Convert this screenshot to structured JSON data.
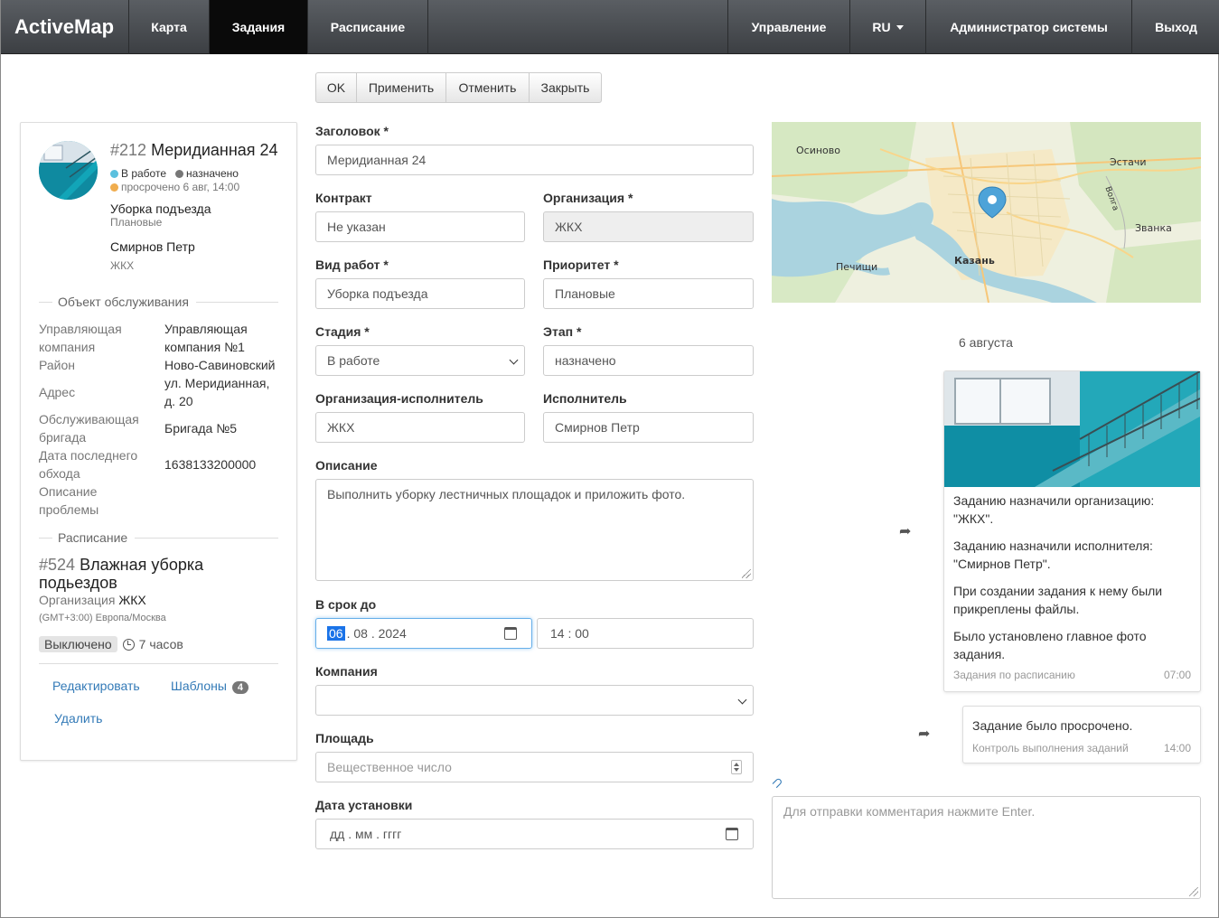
{
  "navbar": {
    "brand": "ActiveMap",
    "items": [
      {
        "label": "Карта"
      },
      {
        "label": "Задания"
      },
      {
        "label": "Расписание"
      }
    ],
    "right_items": [
      {
        "label": "Управление"
      },
      {
        "label": "RU"
      },
      {
        "label": "Администратор системы"
      },
      {
        "label": "Выход"
      }
    ]
  },
  "toolbar": {
    "ok": "OK",
    "apply": "Применить",
    "cancel": "Отменить",
    "close": "Закрыть"
  },
  "card": {
    "task_number": "#212",
    "task_title": "Меридианная 24",
    "stage": "В работе",
    "stage_color": "#5bc0de",
    "step": "назначено",
    "step_color": "#777777",
    "overdue": "просрочено 6 авг, 14:00",
    "overdue_color": "#f0ad4e",
    "work_type": "Уборка подъезда",
    "priority": "Плановые",
    "executor": "Смирнов Петр",
    "executor_org": "ЖКХ",
    "object_section": "Объект обслуживания",
    "fields": {
      "mgmt_label": "Управляющая компания",
      "mgmt_value": "Управляющая компания №1",
      "district_label": "Район",
      "district_value": "Ново-Савиновский",
      "address_label": "Адрес",
      "address_value": "ул. Меридианная, д. 20",
      "brigade_label": "Обслуживающая бригада",
      "brigade_value": "Бригада №5",
      "last_visit_label": "Дата последнего обхода",
      "last_visit_value": "1638133200000",
      "problem_label": "Описание проблемы",
      "problem_value": ""
    },
    "schedule_section": "Расписание",
    "schedule_number": "#524",
    "schedule_title": "Влажная уборка подьездов",
    "schedule_org_label": "Организация",
    "schedule_org_value": "ЖКХ",
    "timezone": "(GMT+3:00) Европа/Москва",
    "schedule_state": "Выключено",
    "schedule_period": "7 часов",
    "edit_link": "Редактировать",
    "templates_link": "Шаблоны",
    "templates_count": "4",
    "delete_link": "Удалить"
  },
  "form": {
    "title_label": "Заголовок *",
    "title_value": "Меридианная 24",
    "contract_label": "Контракт",
    "contract_value": "Не указан",
    "org_label": "Организация *",
    "org_value": "ЖКХ",
    "worktype_label": "Вид работ *",
    "worktype_value": "Уборка подъезда",
    "priority_label": "Приоритет *",
    "priority_value": "Плановые",
    "stage_label": "Стадия *",
    "stage_value": "В работе",
    "step_label": "Этап *",
    "step_value": "назначено",
    "exec_org_label": "Организация-исполнитель",
    "exec_org_value": "ЖКХ",
    "executor_label": "Исполнитель",
    "executor_value": "Смирнов Петр",
    "description_label": "Описание",
    "description_value": "Выполнить уборку лестничных площадок и приложить фото.",
    "deadline_label": "В срок до",
    "deadline_day": "06",
    "deadline_rest": ". 08 . 2024",
    "deadline_time": "14 : 00",
    "company_label": "Компания",
    "company_value": "",
    "area_label": "Площадь",
    "area_placeholder": "Вещественное число",
    "install_date_label": "Дата установки",
    "install_date_value": "дд . мм . гггг"
  },
  "map": {
    "labels": {
      "osinovo": "Осиново",
      "estachi": "Эстачи",
      "zvanka": "Званка",
      "pechischi": "Печищи",
      "kazan": "Казань",
      "volga": "Волга"
    }
  },
  "timeline": {
    "date": "6 августа",
    "msg1": {
      "lines": [
        "Заданию назначили организацию: \"ЖКХ\".",
        "Заданию назначили исполнителя: \"Смирнов Петр\".",
        "При создании задания к нему были прикреплены файлы.",
        "Было установлено главное фото задания."
      ],
      "source": "Задания по расписанию",
      "time": "07:00"
    },
    "msg2": {
      "text": "Задание было просрочено.",
      "source": "Контроль выполнения заданий",
      "time": "14:00"
    },
    "comment_placeholder": "Для отправки комментария нажмите Enter."
  }
}
